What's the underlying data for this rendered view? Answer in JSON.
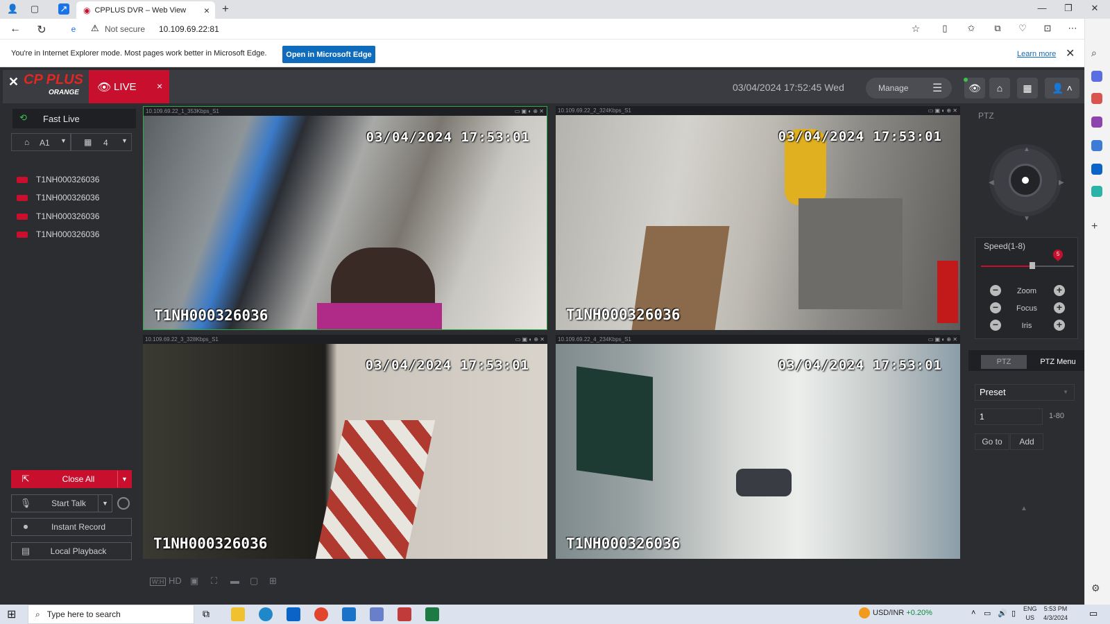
{
  "browser": {
    "tab_title": "CPPLUS DVR – Web View",
    "new_tab": "+",
    "not_secure": "Not secure",
    "url": "10.109.69.22:81",
    "ie_banner": "You're in Internet Explorer mode. Most pages work better in Microsoft Edge.",
    "open_edge": "Open in Microsoft Edge",
    "learn_more": "Learn more"
  },
  "app": {
    "logo": "CP PLUS",
    "logo_sub": "ORANGE",
    "live_label": "LIVE",
    "datetime": "03/04/2024 17:52:45 Wed",
    "manage_label": "Manage"
  },
  "left_panel": {
    "fast_live": "Fast Live",
    "stream_select": "A1",
    "layout_select": "4",
    "channels": [
      "T1NH000326036",
      "T1NH000326036",
      "T1NH000326036",
      "T1NH000326036"
    ],
    "buttons": {
      "close_all": "Close All",
      "start_talk": "Start Talk",
      "instant_record": "Instant Record",
      "local_playback": "Local Playback"
    }
  },
  "cameras": [
    {
      "head": "10.109.69.22_1_353Kbps_S1",
      "timestamp": "03/04/2024 17:53:01",
      "name": "T1NH000326036"
    },
    {
      "head": "10.109.69.22_2_324Kbps_S1",
      "timestamp": "03/04/2024 17:53:01",
      "name": "T1NH000326036"
    },
    {
      "head": "10.109.69.22_3_328Kbps_S1",
      "timestamp": "03/04/2024 17:53:01",
      "name": "T1NH000326036"
    },
    {
      "head": "10.109.69.22_4_234Kbps_S1",
      "timestamp": "03/04/2024 17:53:01",
      "name": "T1NH000326036"
    }
  ],
  "bottom_tools": {
    "hd": "HD"
  },
  "ptz": {
    "title": "PTZ",
    "speed_label": "Speed(1-8)",
    "speed_value": "5",
    "zoom": "Zoom",
    "focus": "Focus",
    "iris": "Iris",
    "tab_ptz": "PTZ",
    "tab_menu": "PTZ Menu",
    "preset_select": "Preset",
    "preset_input": "1",
    "preset_range": "1-80",
    "goto": "Go to",
    "add": "Add"
  },
  "taskbar": {
    "search_placeholder": "Type here to search",
    "ticker_label": "USD/INR",
    "ticker_change": "+0.20%",
    "lang_top": "ENG",
    "lang_bottom": "US",
    "time": "5:53 PM",
    "date": "4/3/2024"
  },
  "colors": {
    "brand_red": "#c8102e",
    "edge_blue": "#0f6cbd"
  }
}
